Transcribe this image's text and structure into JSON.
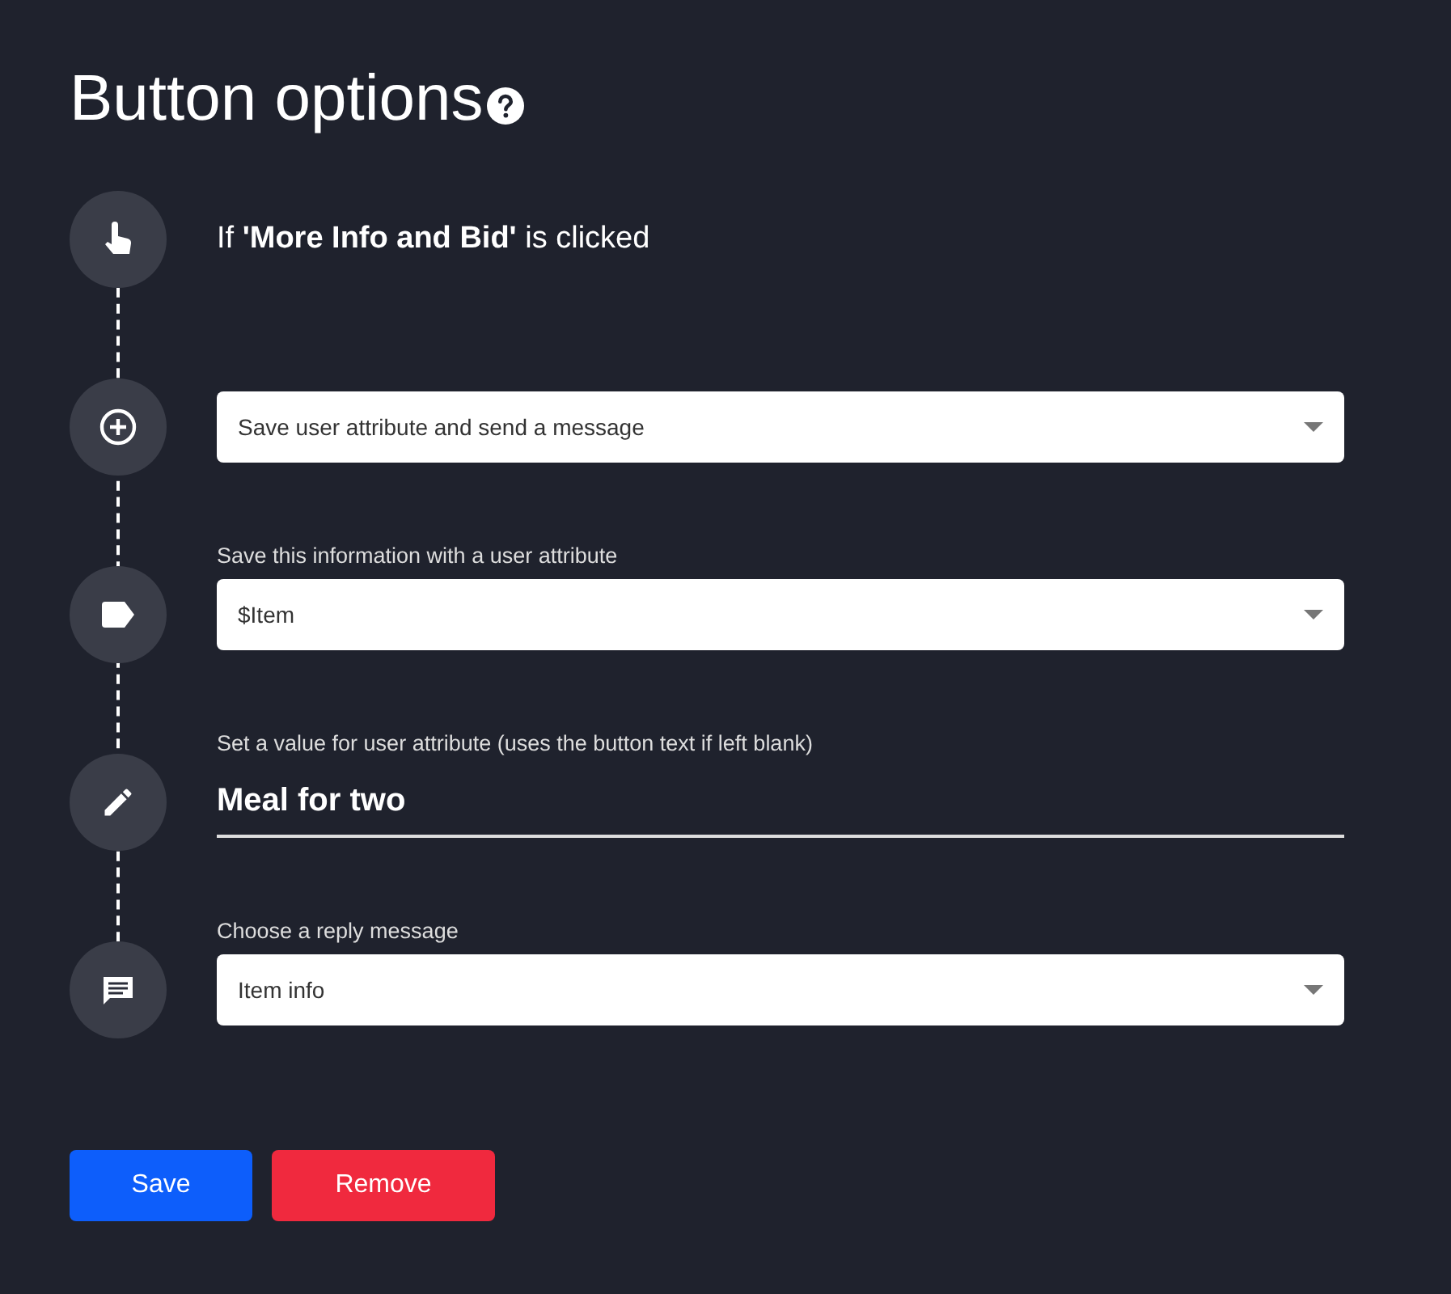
{
  "dialog": {
    "title": "Button options",
    "steps": [
      {
        "kind": "trigger",
        "text": "If **'More Info and Bid'** is clicked"
      },
      {
        "kind": "action",
        "value": "Save user attribute and send a message"
      },
      {
        "kind": "attribute",
        "label": "Save this information with a user attribute",
        "value": "$Item"
      },
      {
        "kind": "value",
        "label": "Set a value for user attribute (uses the button text if left blank)",
        "value": "Meal for two"
      },
      {
        "kind": "reply",
        "label": "Choose a reply message",
        "value": "Item info"
      }
    ],
    "buttons": [
      {
        "label": "Save",
        "kind": "primary"
      },
      {
        "label": "Remove",
        "kind": "danger"
      }
    ]
  }
}
